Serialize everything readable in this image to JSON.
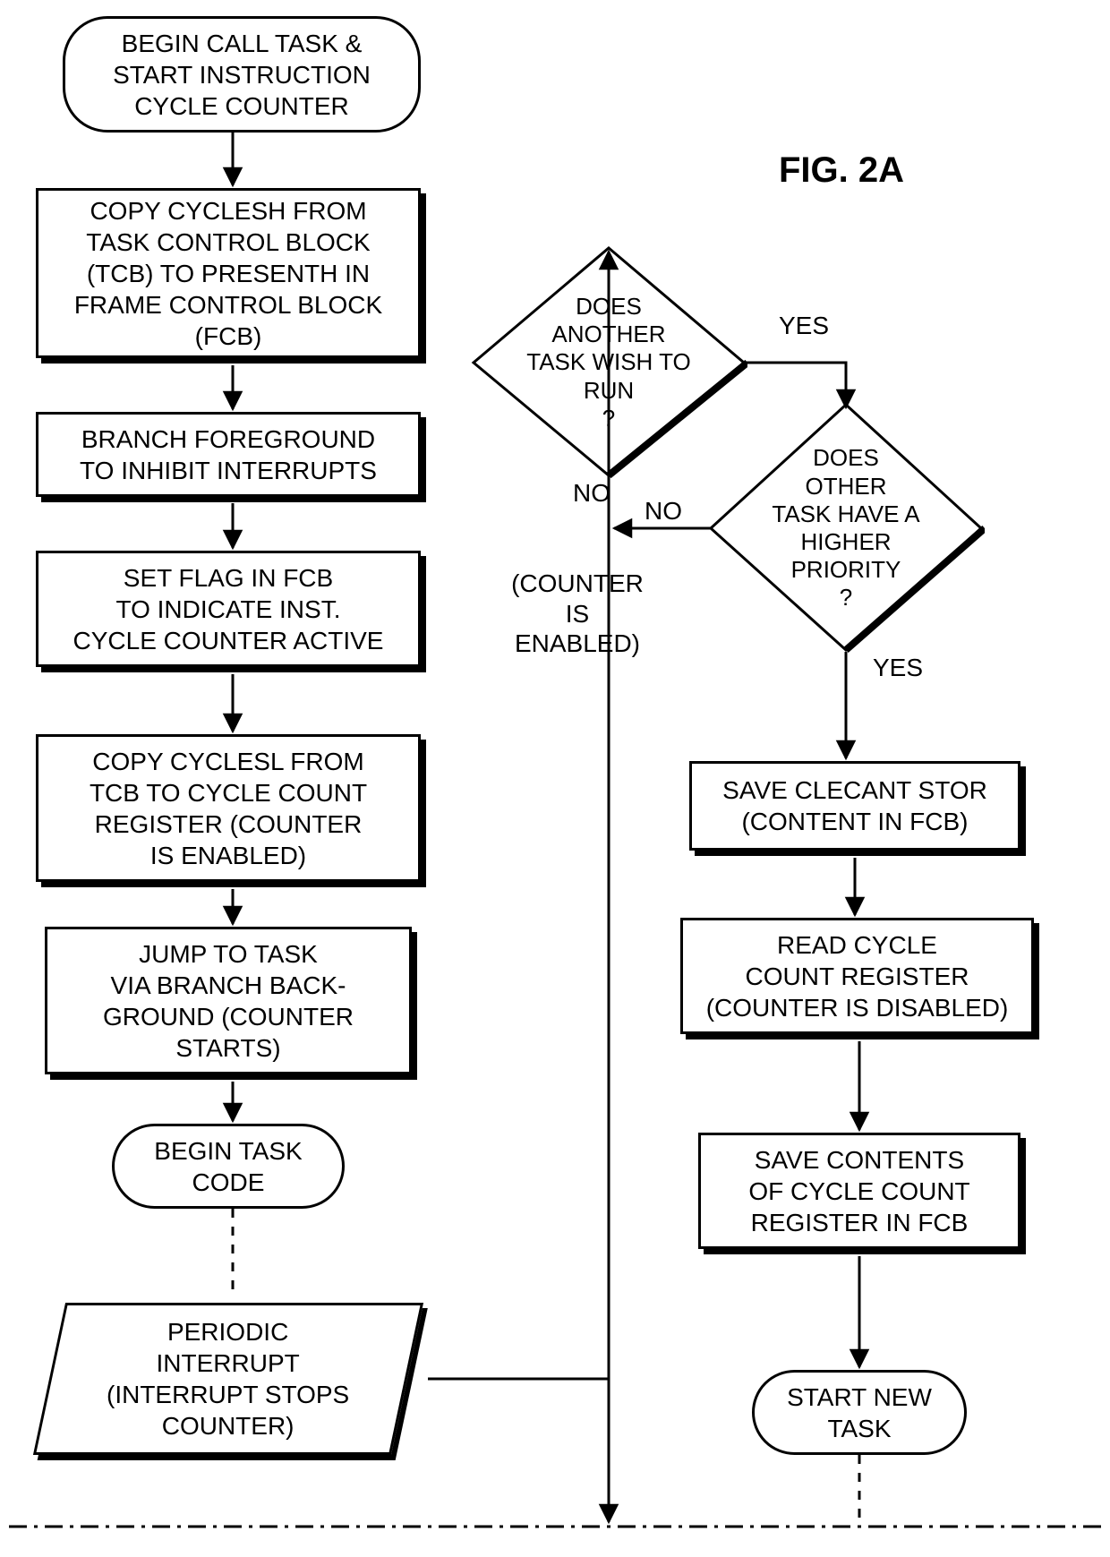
{
  "figure_title": "FIG. 2A",
  "nodes": {
    "start": "BEGIN CALL TASK &\nSTART INSTRUCTION\nCYCLE COUNTER",
    "p1": "COPY CYCLESH FROM\nTASK CONTROL BLOCK\n(TCB) TO PRESENTH IN\nFRAME CONTROL BLOCK\n(FCB)",
    "p2": "BRANCH FOREGROUND\nTO INHIBIT INTERRUPTS",
    "p3": "SET FLAG IN FCB\nTO INDICATE INST.\nCYCLE COUNTER ACTIVE",
    "p4": "COPY CYCLESL FROM\nTCB TO CYCLE COUNT\nREGISTER (COUNTER\nIS ENABLED)",
    "p5": "JUMP TO TASK\nVIA BRANCH BACK-\nGROUND (COUNTER\nSTARTS)",
    "begin_task": "BEGIN TASK\nCODE",
    "interrupt": "PERIODIC\nINTERRUPT\n(INTERRUPT STOPS\nCOUNTER)",
    "d1": "DOES\nANOTHER\nTASK WISH TO\nRUN\n?",
    "d2": "DOES\nOTHER\nTASK HAVE A\nHIGHER\nPRIORITY\n?",
    "p6": "SAVE CLECANT STOR\n(CONTENT IN FCB)",
    "p7": "READ CYCLE\nCOUNT REGISTER\n(COUNTER IS DISABLED)",
    "p8": "SAVE CONTENTS\nOF CYCLE COUNT\nREGISTER IN FCB",
    "start_new": "START NEW\nTASK"
  },
  "labels": {
    "yes1": "YES",
    "no1": "NO",
    "yes2": "YES",
    "no2": "NO",
    "counter_enabled": "(COUNTER\nIS\nENABLED)"
  }
}
